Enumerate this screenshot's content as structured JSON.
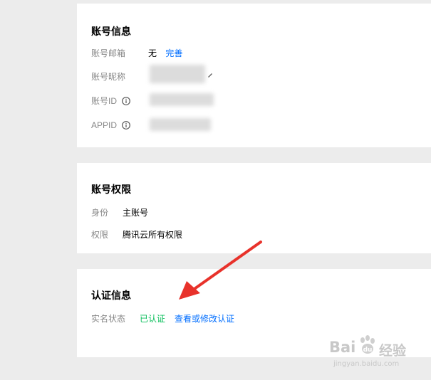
{
  "account_info": {
    "title": "账号信息",
    "email_label": "账号邮箱",
    "email_value": "无",
    "email_action": "完善",
    "nickname_label": "账号昵称",
    "id_label": "账号ID",
    "appid_label": "APPID"
  },
  "permissions": {
    "title": "账号权限",
    "role_label": "身份",
    "role_value": "主账号",
    "scope_label": "权限",
    "scope_value": "腾讯云所有权限"
  },
  "auth_info": {
    "title": "认证信息",
    "status_label": "实名状态",
    "status_value": "已认证",
    "modify_link": "查看或修改认证"
  },
  "watermark": {
    "brand": "Bai",
    "brand_suffix": "经验",
    "url": "jingyan.baidu.com"
  },
  "colors": {
    "link": "#006eff",
    "success": "#0abf5b",
    "arrow": "#e8322b"
  }
}
